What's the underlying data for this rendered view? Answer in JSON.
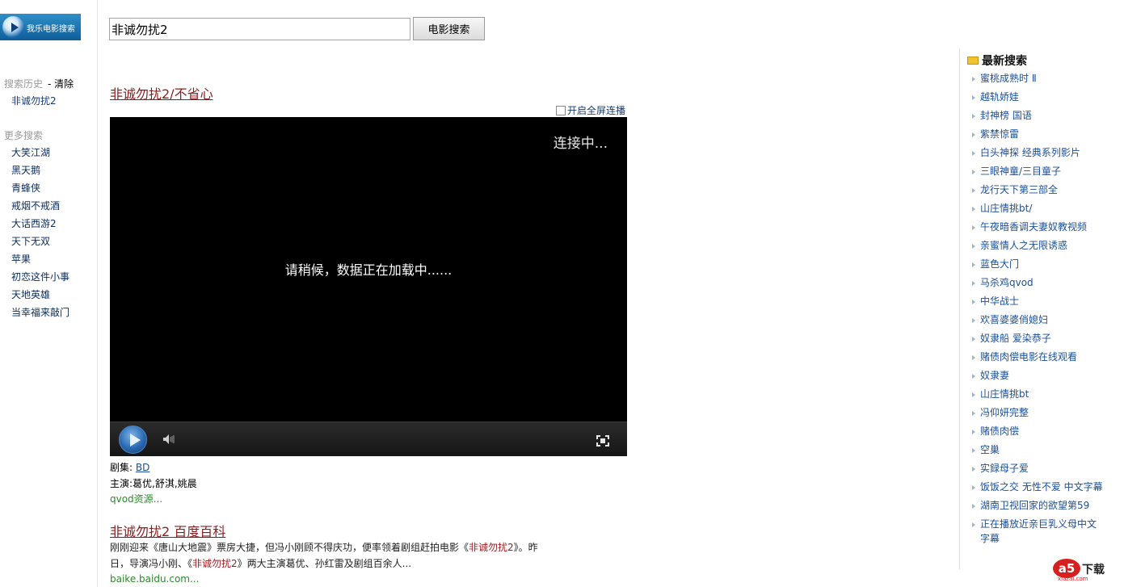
{
  "logo": {
    "text": "我乐电影搜索"
  },
  "search": {
    "value": "非诚勿扰2",
    "button_label": "电影搜索"
  },
  "sidebar": {
    "history_title": "搜索历史",
    "clear_label": "- 清除",
    "history": [
      "非诚勿扰2"
    ],
    "more_title": "更多搜索",
    "more": [
      "大笑江湖",
      "黑天鹅",
      "青蜂侠",
      "戒烟不戒酒",
      "大话西游2",
      "天下无双",
      "苹果",
      "初恋这件小事",
      "天地英雄",
      "当幸福来敲门"
    ]
  },
  "result1": {
    "title": "非诚勿扰2/不省心",
    "fullscreen_label": "开启全屏连播",
    "player": {
      "status": "连接中...",
      "loading": "请稍候，数据正在加载中......"
    },
    "episodes_label": "剧集:",
    "episode": "BD",
    "cast_label": "主演:",
    "cast": "葛优,舒淇,姚晨",
    "source": "qvod资源..."
  },
  "result2": {
    "title": "非诚勿扰2  百度百科",
    "snippet_pre": "刚刚迎来《唐山大地震》票房大捷，但冯小刚顾不得庆功，便率领着剧组赶拍电影《",
    "snippet_hl1": "非诚勿扰2",
    "snippet_mid": "》。昨日，导演冯小刚、《",
    "snippet_hl2": "非诚勿扰2",
    "snippet_post": "》两大主演葛优、孙红雷及剧组百余人...",
    "source": "baike.baidu.com..."
  },
  "latest": {
    "title": "最新搜索",
    "items": [
      "蜜桃成熟时 Ⅱ",
      "越轨娇娃",
      "封神榜 国语",
      "紫禁惊雷",
      "白头神探 经典系列影片",
      "三眼神童/三目童子",
      "龙行天下第三部全",
      "山庄情挑bt/",
      "午夜暗香调夫妻奴教视频",
      "亲蜜情人之无限诱惑",
      "蓝色大门",
      "马杀鸡qvod",
      "中华战士",
      "欢喜婆婆俏媳妇",
      "奴隶船  爱染恭子",
      "赌债肉偿电影在线观看",
      "奴隶妻",
      "山庄情挑bt",
      "冯仰妍完整",
      "赌债肉偿",
      "空巢",
      "实録母子爱",
      "饭饭之交 无性不爱 中文字幕",
      "湖南卫视回家的欲望第59",
      "正在播放近亲巨乳义母中文字幕"
    ]
  },
  "watermark": {
    "brand": "a5",
    "label": "下载",
    "domain": "xiazai.com"
  }
}
